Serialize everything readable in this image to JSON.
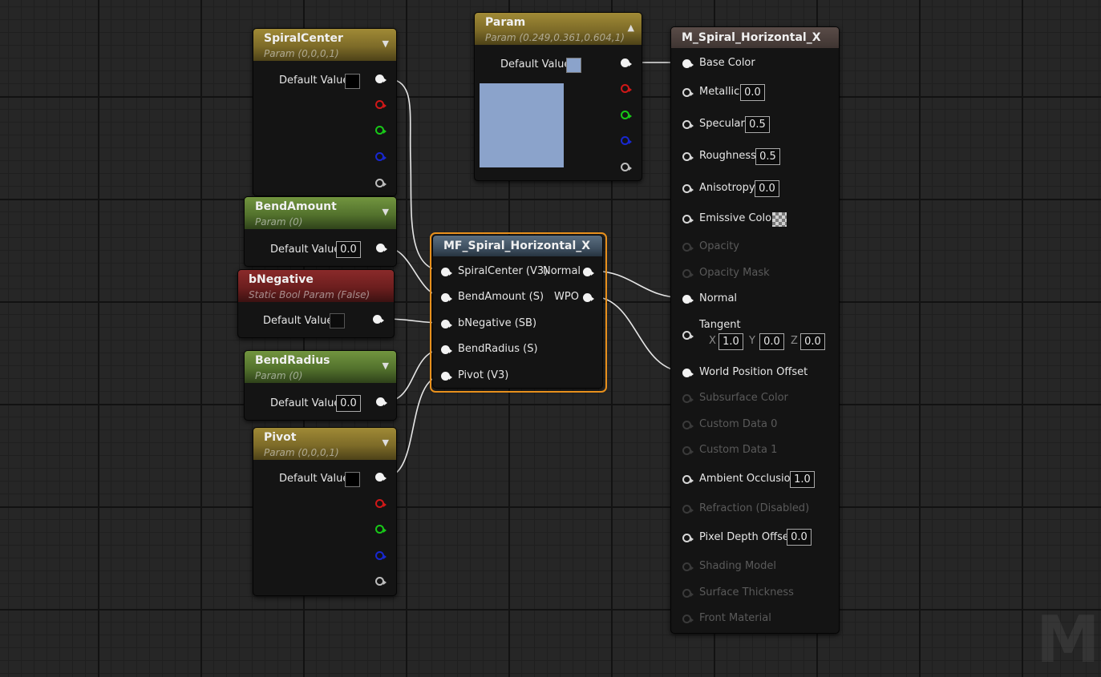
{
  "nodes": {
    "spiral_center": {
      "title": "SpiralCenter",
      "subtitle": "Param (0,0,0,1)",
      "default_label": "Default Value",
      "swatch_color": "#000000"
    },
    "bend_amount": {
      "title": "BendAmount",
      "subtitle": "Param (0)",
      "default_label": "Default Value",
      "value": "0.0"
    },
    "b_negative": {
      "title": "bNegative",
      "subtitle": "Static Bool Param (False)",
      "default_label": "Default Value",
      "checked": false
    },
    "bend_radius": {
      "title": "BendRadius",
      "subtitle": "Param (0)",
      "default_label": "Default Value",
      "value": "0.0"
    },
    "pivot": {
      "title": "Pivot",
      "subtitle": "Param (0,0,0,1)",
      "default_label": "Default Value",
      "swatch_color": "#000000"
    },
    "param": {
      "title": "Param",
      "subtitle": "Param (0.249,0.361,0.604,1)",
      "default_label": "Default Value",
      "color": "#8ba3cb"
    },
    "function": {
      "title": "MF_Spiral_Horizontal_X",
      "inputs": [
        "SpiralCenter (V3)",
        "BendAmount (S)",
        "bNegative (SB)",
        "BendRadius (S)",
        "Pivot (V3)"
      ],
      "outputs": [
        "Normal",
        "WPO"
      ]
    },
    "material": {
      "title": "M_Spiral_Horizontal_X",
      "inputs": {
        "base_color": "Base Color",
        "metallic": {
          "label": "Metallic",
          "value": "0.0"
        },
        "specular": {
          "label": "Specular",
          "value": "0.5"
        },
        "roughness": {
          "label": "Roughness",
          "value": "0.5"
        },
        "anisotropy": {
          "label": "Anisotropy",
          "value": "0.0"
        },
        "emissive": "Emissive Color",
        "opacity": "Opacity",
        "opacity_mask": "Opacity Mask",
        "normal": "Normal",
        "tangent": {
          "label": "Tangent",
          "x_label": "X",
          "x": "1.0",
          "y_label": "Y",
          "y": "0.0",
          "z_label": "Z",
          "z": "0.0"
        },
        "wpo": "World Position Offset",
        "subsurface": "Subsurface Color",
        "custom0": "Custom Data 0",
        "custom1": "Custom Data 1",
        "ao": {
          "label": "Ambient Occlusion",
          "value": "1.0"
        },
        "refraction": "Refraction (Disabled)",
        "pdo": {
          "label": "Pixel Depth Offset",
          "value": "0.0"
        },
        "shading_model": "Shading Model",
        "surface_thickness": "Surface Thickness",
        "front_material": "Front Material"
      }
    }
  },
  "icons": {
    "collapse": "chevron-down-icon",
    "expand": "chevron-up-icon",
    "pin_colors": {
      "rgba": "#f2f2f2",
      "r": "#d01818",
      "g": "#18c818",
      "b": "#1828d0",
      "a": "#bdbdbd"
    }
  },
  "colors": {
    "selected_outline": "#e8901c",
    "wire": "#e8e8e8"
  },
  "watermark": "MA"
}
